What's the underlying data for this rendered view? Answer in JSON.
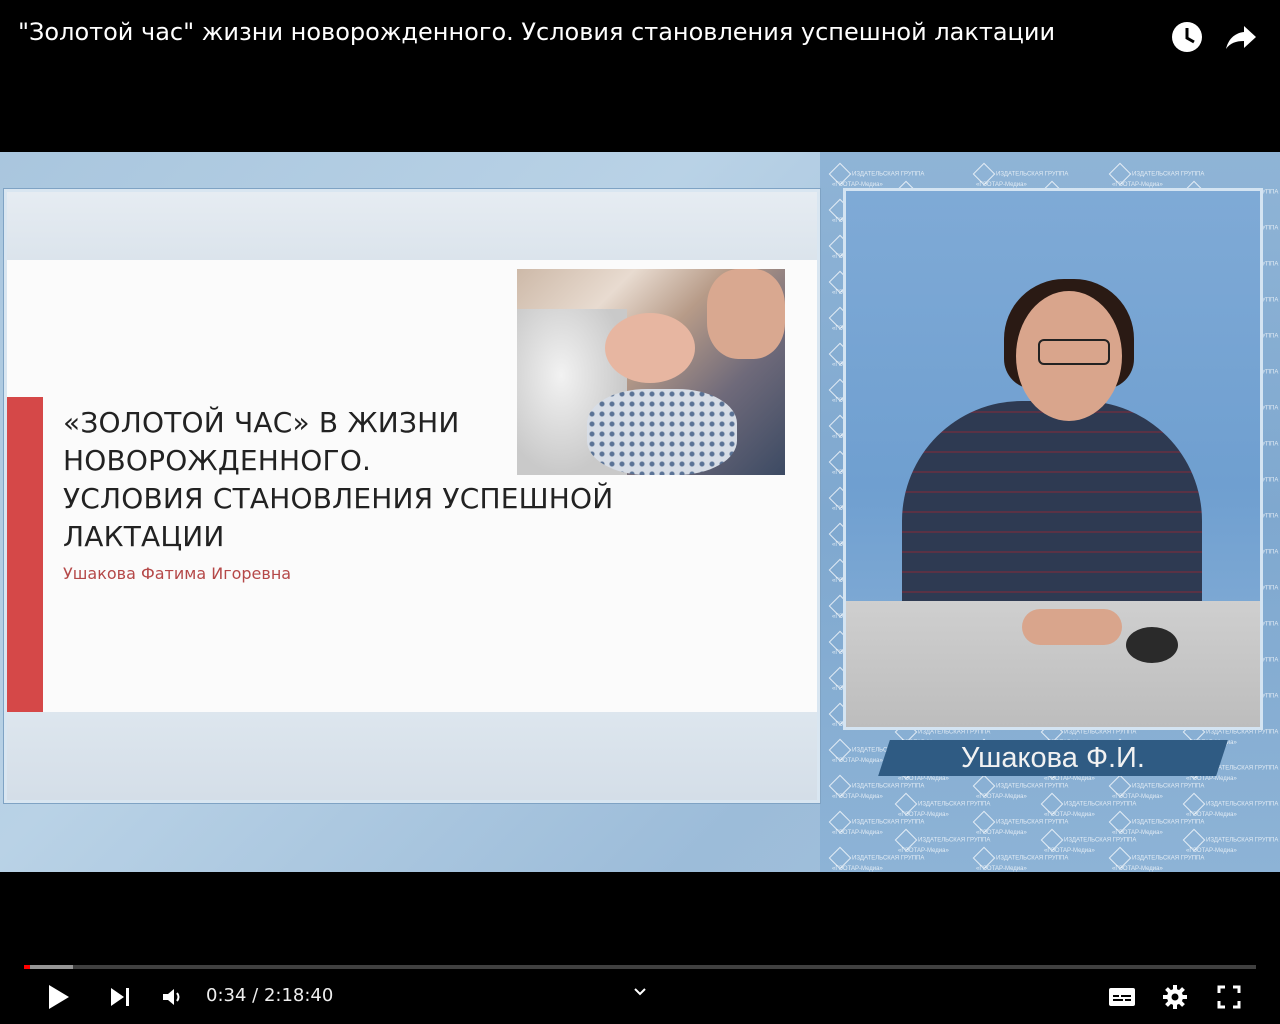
{
  "video": {
    "title": "\"Золотой час\" жизни новорожденного. Условия становления успешной лактации"
  },
  "top_actions": [
    {
      "name": "watch-later",
      "icon": "clock-icon"
    },
    {
      "name": "share",
      "icon": "share-arrow-icon"
    }
  ],
  "slide": {
    "title_lines": [
      "«ЗОЛОТОЙ ЧАС» В ЖИЗНИ",
      "НОВОРОЖДЕННОГО.",
      "УСЛОВИЯ СТАНОВЛЕНИЯ УСПЕШНОЙ",
      "ЛАКТАЦИИ"
    ],
    "author": "Ушакова Фатима Игоревна",
    "accent_color": "#d54848"
  },
  "watermark": {
    "line1": "ИЗДАТЕЛЬСКАЯ ГРУППА",
    "line2": "«ГЭОТАР-Медиа»"
  },
  "presenter": {
    "caption": "Ушакова Ф.И."
  },
  "player": {
    "current_time": "0:34",
    "separator": " / ",
    "duration": "2:18:40",
    "progress_fraction": 0.0041,
    "buffered_fraction": 0.04,
    "play_icon": "play-icon",
    "next_icon": "next-icon",
    "volume_icon": "volume-icon",
    "subtitles_icon": "subtitles-icon",
    "settings_icon": "gear-icon",
    "fullscreen_icon": "fullscreen-icon",
    "progress_color": "#ff0000"
  }
}
